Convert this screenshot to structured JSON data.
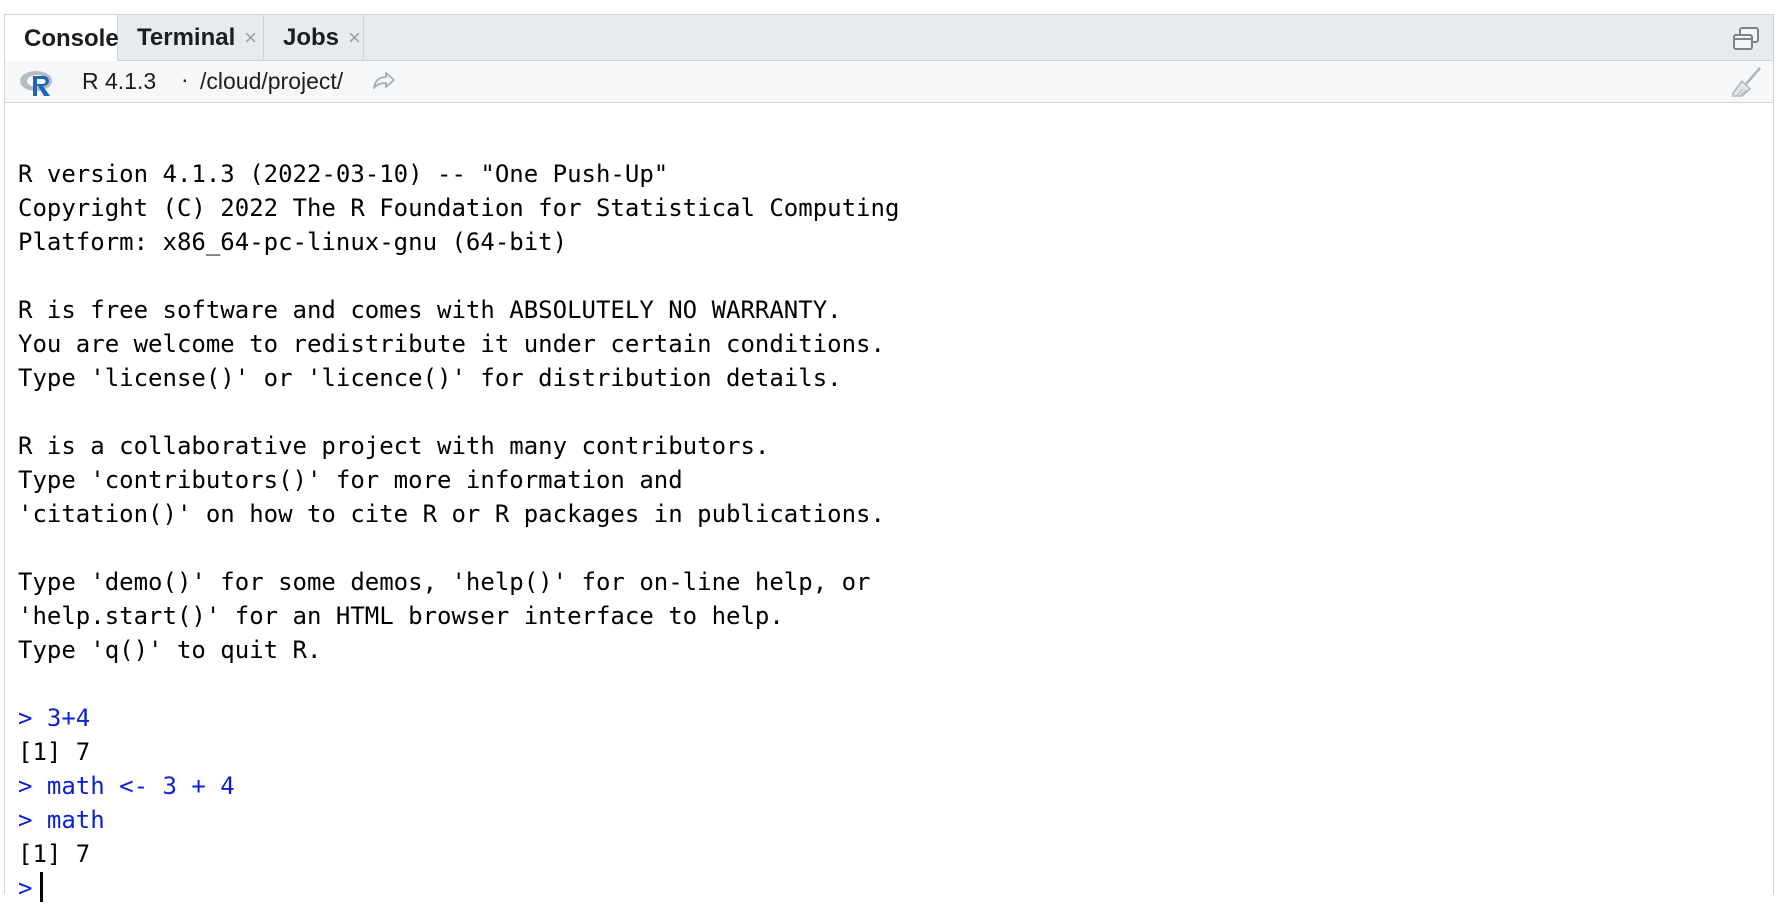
{
  "tabs": [
    {
      "label": "Console"
    },
    {
      "label": "Terminal",
      "close": "×"
    },
    {
      "label": "Jobs",
      "close": "×"
    }
  ],
  "pathbar": {
    "version": "R 4.1.3",
    "separator": "·",
    "path": "/cloud/project/"
  },
  "console": {
    "lines": [
      {
        "text": "",
        "kind": "output"
      },
      {
        "text": "R version 4.1.3 (2022-03-10) -- \"One Push-Up\"",
        "kind": "output"
      },
      {
        "text": "Copyright (C) 2022 The R Foundation for Statistical Computing",
        "kind": "output"
      },
      {
        "text": "Platform: x86_64-pc-linux-gnu (64-bit)",
        "kind": "output"
      },
      {
        "text": "",
        "kind": "output"
      },
      {
        "text": "R is free software and comes with ABSOLUTELY NO WARRANTY.",
        "kind": "output"
      },
      {
        "text": "You are welcome to redistribute it under certain conditions.",
        "kind": "output"
      },
      {
        "text": "Type 'license()' or 'licence()' for distribution details.",
        "kind": "output"
      },
      {
        "text": "",
        "kind": "output"
      },
      {
        "text": "R is a collaborative project with many contributors.",
        "kind": "output"
      },
      {
        "text": "Type 'contributors()' for more information and",
        "kind": "output"
      },
      {
        "text": "'citation()' on how to cite R or R packages in publications.",
        "kind": "output"
      },
      {
        "text": "",
        "kind": "output"
      },
      {
        "text": "Type 'demo()' for some demos, 'help()' for on-line help, or",
        "kind": "output"
      },
      {
        "text": "'help.start()' for an HTML browser interface to help.",
        "kind": "output"
      },
      {
        "text": "Type 'q()' to quit R.",
        "kind": "output"
      },
      {
        "text": "",
        "kind": "output"
      },
      {
        "text": "> 3+4",
        "kind": "input"
      },
      {
        "text": "[1] 7",
        "kind": "output"
      },
      {
        "text": "> math <- 3 + 4",
        "kind": "input"
      },
      {
        "text": "> math",
        "kind": "input"
      },
      {
        "text": "[1] 7",
        "kind": "output"
      }
    ],
    "prompt": ">"
  }
}
